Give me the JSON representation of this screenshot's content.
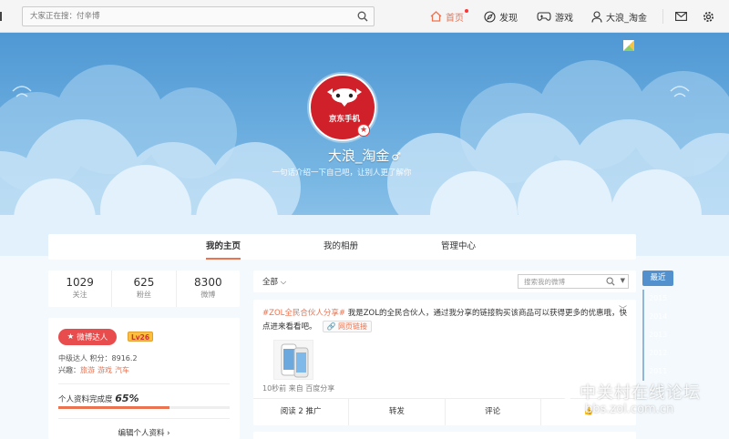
{
  "topbar": {
    "search_placeholder": "大家正在搜：付辛博",
    "nav": {
      "home": "首页",
      "discover": "发现",
      "games": "游戏",
      "user": "大浪_淘金"
    }
  },
  "profile_header": {
    "avatar_text": "京东手机",
    "username": "大浪_淘金",
    "gender_symbol": "♂",
    "bio": "一句话介绍一下自己吧，让别人更了解你"
  },
  "tabs": [
    "我的主页",
    "我的相册",
    "管理中心"
  ],
  "stats": [
    {
      "value": "1029",
      "label": "关注"
    },
    {
      "value": "625",
      "label": "粉丝"
    },
    {
      "value": "8300",
      "label": "微博"
    }
  ],
  "profile_card": {
    "talent_badge": "微博达人",
    "level": "Lv26",
    "rank_line": "中级达人  积分：8916.2",
    "interests_label": "兴趣：",
    "interests": [
      "旅游",
      "游戏",
      "汽车"
    ],
    "completion_label": "个人资料完成度",
    "completion_value": "65%",
    "completion_fraction": 0.65,
    "edit_label": "编辑个人资料 ›"
  },
  "feed": {
    "filter_all": "全部",
    "search_placeholder": "搜索我的微博",
    "post": {
      "hashtag": "#ZOL全民合伙人分享#",
      "body": " 我是ZOL的全民合伙人，通过我分享的链接购买该商品可以获得更多的优惠哦，快点进来看看吧。",
      "link_label": "网页链接",
      "meta": "10秒前 来自 百度分享",
      "actions": [
        "阅读 2    推广",
        "转发",
        "评论",
        "👍"
      ]
    }
  },
  "timeline": {
    "active": "最近",
    "years": [
      "2015",
      "2014",
      "2013",
      "2012",
      "2011"
    ]
  },
  "watermark": {
    "title": "中关村在线论坛",
    "url": "bbs.zol.com.cn"
  },
  "colors": {
    "accent": "#eb7350",
    "cover_sky": "#5fa6d8",
    "avatar_red": "#d0202a",
    "talent_red": "#e94c4c"
  }
}
